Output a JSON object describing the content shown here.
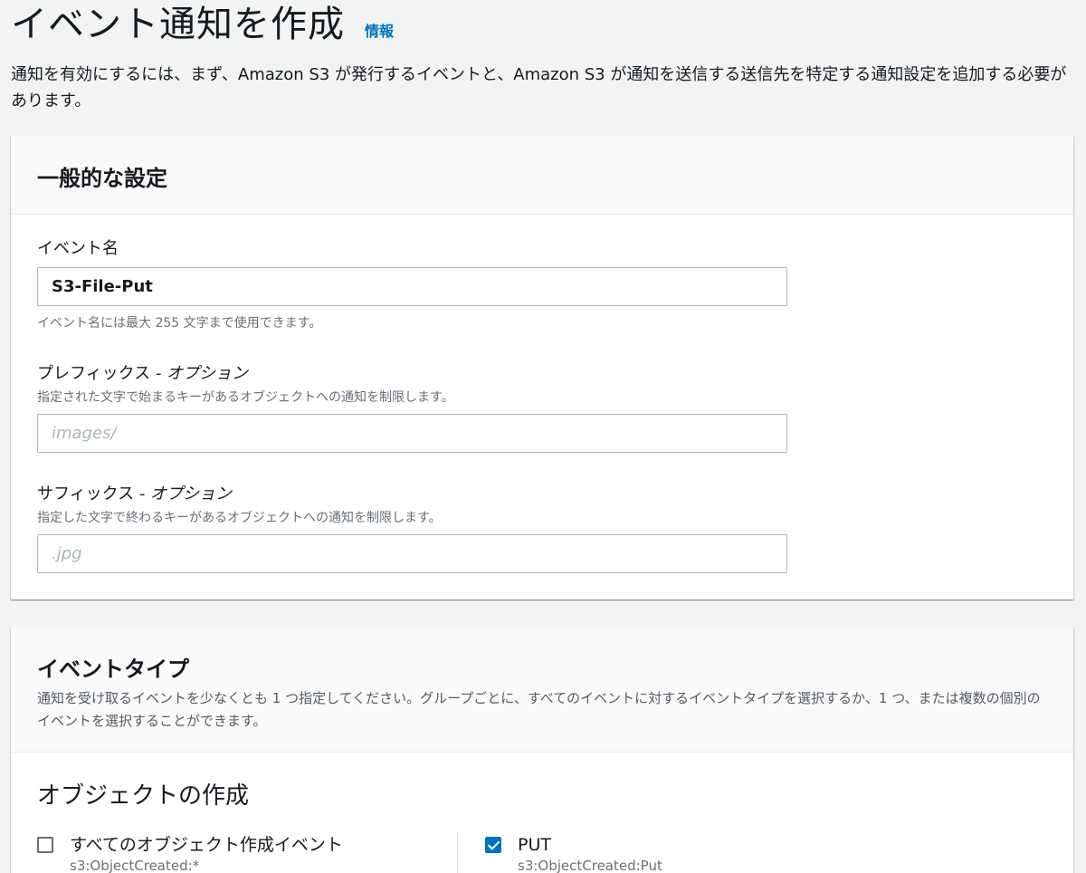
{
  "page": {
    "title": "イベント通知を作成",
    "info_link": "情報",
    "intro": "通知を有効にするには、まず、Amazon S3 が発行するイベントと、Amazon S3 が通知を送信する送信先を特定する通知設定を追加する必要があります。"
  },
  "general": {
    "heading": "一般的な設定",
    "event_name": {
      "label": "イベント名",
      "value": "S3-File-Put",
      "hint": "イベント名には最大 255 文字まで使用できます。"
    },
    "prefix": {
      "label": "プレフィックス",
      "optional": " - オプション",
      "description": "指定された文字で始まるキーがあるオブジェクトへの通知を制限します。",
      "placeholder": "images/"
    },
    "suffix": {
      "label": "サフィックス",
      "optional": " - オプション",
      "description": "指定した文字で終わるキーがあるオブジェクトへの通知を制限します。",
      "placeholder": ".jpg"
    }
  },
  "event_types": {
    "heading": "イベントタイプ",
    "description": "通知を受け取るイベントを少なくとも 1 つ指定してください。グループごとに、すべてのイベントに対するイベントタイプを選択するか、1 つ、または複数の個別のイベントを選択することができます。",
    "object_creation": {
      "title": "オブジェクトの作成",
      "options": [
        {
          "label": "すべてのオブジェクト作成イベント",
          "sub": "s3:ObjectCreated:*",
          "checked": false
        },
        {
          "label": "PUT",
          "sub": "s3:ObjectCreated:Put",
          "checked": true
        }
      ]
    }
  },
  "colors": {
    "accent": "#0073bb",
    "background": "#f2f3f3",
    "panel": "#ffffff"
  }
}
